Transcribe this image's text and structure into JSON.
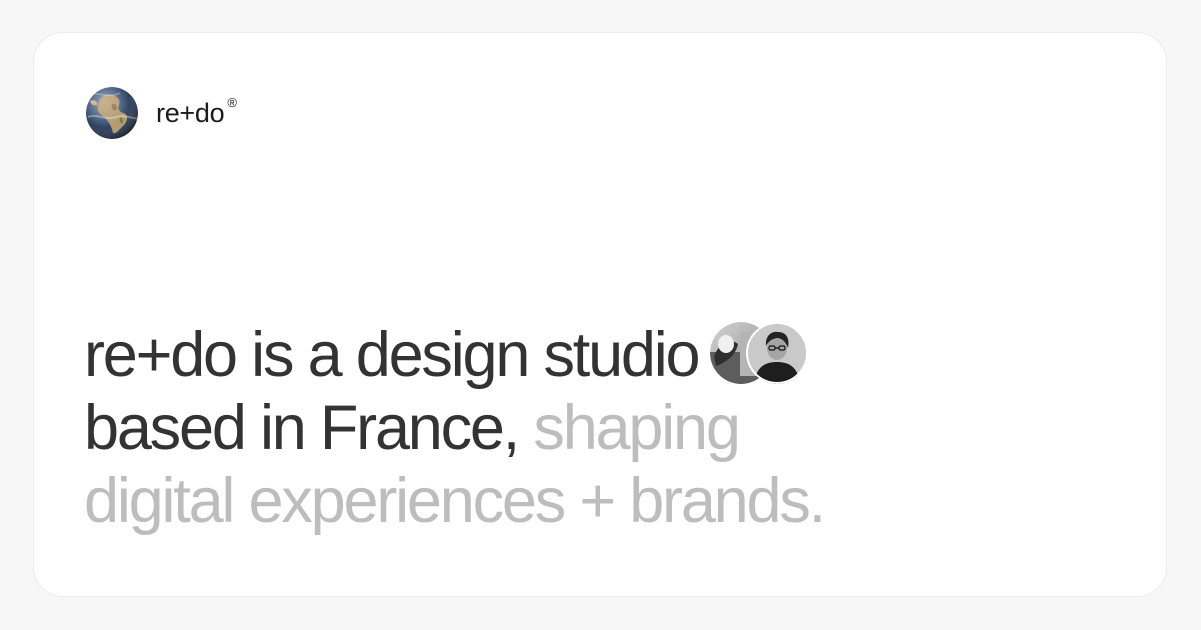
{
  "brand": {
    "name": "re+do",
    "mark": "®",
    "logo_icon": "globe-icon"
  },
  "headline": {
    "line1": "re+do is a design studio",
    "line2_dark": "based in France,",
    "line2_muted": "shaping",
    "line3_muted": "digital experiences + brands."
  },
  "avatars": [
    {
      "icon": "team-photo-avatar"
    },
    {
      "icon": "person-photo-avatar"
    }
  ],
  "colors": {
    "background": "#f7f7f7",
    "card": "#ffffff",
    "text_dark": "#333333",
    "text_muted": "#bdbdbd"
  }
}
